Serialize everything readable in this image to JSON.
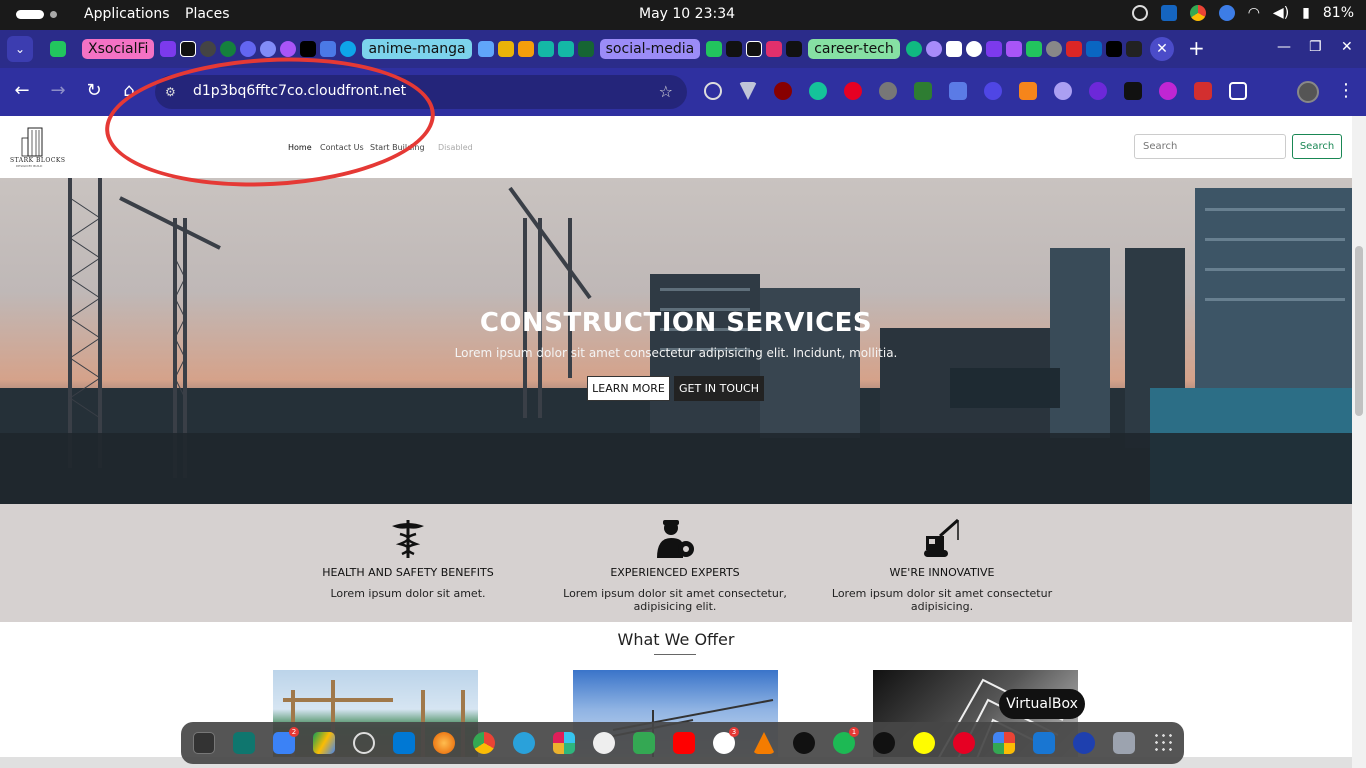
{
  "topbar": {
    "applications": "Applications",
    "places": "Places",
    "clock": "May 10  23:34",
    "battery": "81%"
  },
  "tabs": {
    "groups": [
      "XsocialFi",
      "anime-manga",
      "social-media",
      "career-tech"
    ],
    "close": "✕",
    "new_tab": "+"
  },
  "toolbar": {
    "url": "d1p3bq6fftc7co.cloudfront.net"
  },
  "site": {
    "logo_text": "STARK BLOCKS",
    "logo_tagline": "DESIGN BY BUILD",
    "nav": [
      "Home",
      "Contact Us",
      "Start Building",
      "Disabled"
    ],
    "search_placeholder": "Search",
    "search_button": "Search"
  },
  "hero": {
    "title": "CONSTRUCTION SERVICES",
    "subtitle": "Lorem ipsum dolor sit amet consectetur adipisicing elit. Incidunt, mollitia.",
    "btn_learn": "LEARN MORE",
    "btn_touch": "GET IN TOUCH"
  },
  "features": [
    {
      "icon": "caduceus-icon",
      "title": "HEALTH AND SAFETY BENEFITS",
      "text": "Lorem ipsum dolor sit amet."
    },
    {
      "icon": "engineer-gear-icon",
      "title": "EXPERIENCED EXPERTS",
      "text": "Lorem ipsum dolor sit amet consectetur, adipisicing elit."
    },
    {
      "icon": "crane-excavator-icon",
      "title": "WE'RE INNOVATIVE",
      "text": "Lorem ipsum dolor sit amet consectetur adipisicing."
    }
  ],
  "offer": {
    "title": "What We Offer"
  },
  "dock": {
    "tooltip": "VirtualBox",
    "badges": [
      "2",
      "3",
      "1"
    ]
  }
}
